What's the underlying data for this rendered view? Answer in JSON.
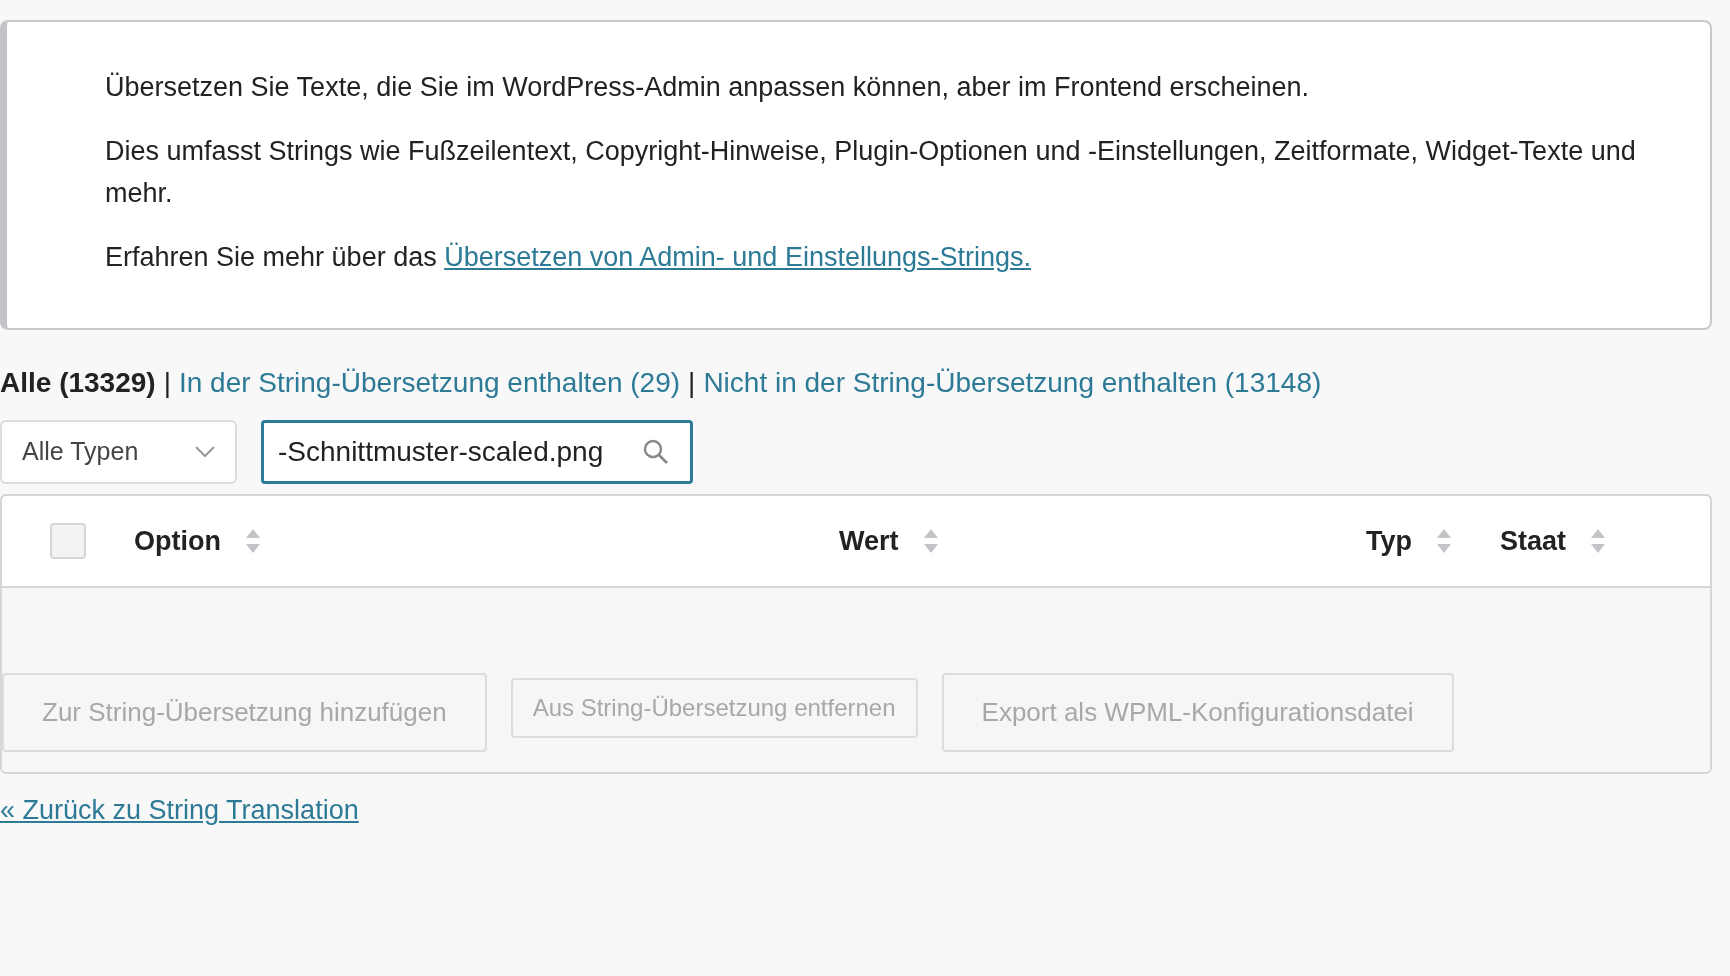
{
  "notice": {
    "paragraphs": [
      "Übersetzen Sie Texte, die Sie im WordPress-Admin anpassen können, aber im Frontend erscheinen.",
      "Dies umfasst Strings wie Fußzeilentext, Copyright-Hinweise, Plugin-Optionen und -Einstellungen, Zeitformate, Widget-Texte und mehr."
    ],
    "learn_more": {
      "text": "Erfahren Sie mehr über das",
      "link": "Übersetzen von Admin- und Einstellungs-Strings."
    }
  },
  "filters": [
    {
      "label": "Alle (13329)",
      "selected": true
    },
    {
      "separator": "|",
      "label": "In der String-Übersetzung enthalten (29)",
      "selected": false
    },
    {
      "separator": "|",
      "label": "Nicht in der String-Übersetzung enthalten (13148)",
      "selected": false
    }
  ],
  "type_select": {
    "value": "Alle Typen"
  },
  "search": {
    "value": "-Schnittmuster-scaled.png"
  },
  "table": {
    "select_all_checked": false,
    "columns": [
      {
        "label": "Option"
      },
      {
        "label": "Wert"
      },
      {
        "label": "Typ"
      },
      {
        "label": "Staat"
      }
    ]
  },
  "buttons": [
    {
      "label": "Zur String-Übersetzung hinzufügen",
      "disabled": true
    },
    {
      "label": "Aus String-Übersetzung entfernen",
      "disabled": true
    },
    {
      "label": "Export als WPML-Konfigurationsdatei",
      "disabled": true
    }
  ],
  "back_link": "« Zurück zu String Translation"
}
